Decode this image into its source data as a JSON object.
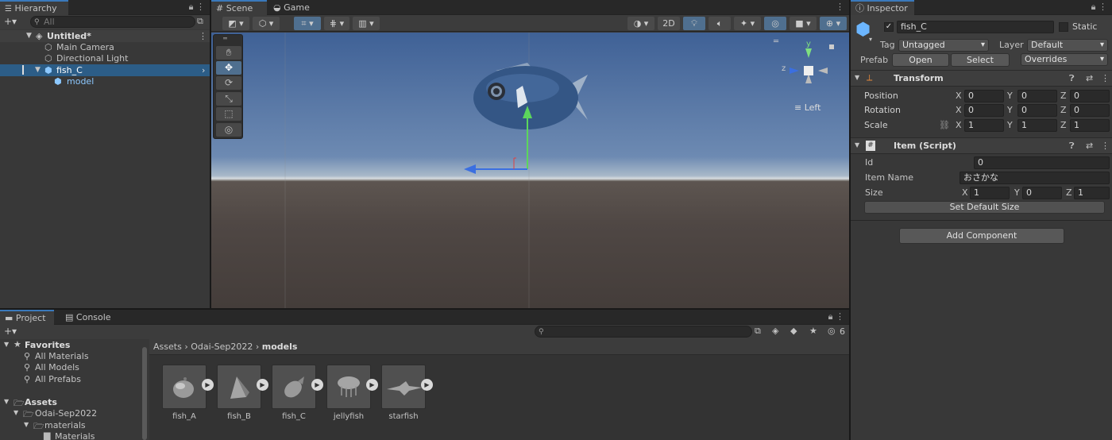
{
  "hierarchy": {
    "tab": "Hierarchy",
    "add_label": "+▾",
    "search_placeholder": "All",
    "scene": "Untitled*",
    "items": [
      "Main Camera",
      "Directional Light",
      "fish_C",
      "model"
    ]
  },
  "scene_view": {
    "tabs": [
      "Scene",
      "Game"
    ],
    "toggle_2d": "2D",
    "view_label": "Left",
    "gizmo_axes": {
      "y": "y",
      "z": "z"
    }
  },
  "inspector": {
    "tab": "Inspector",
    "object_name": "fish_C",
    "static_label": "Static",
    "tag_label": "Tag",
    "tag_value": "Untagged",
    "layer_label": "Layer",
    "layer_value": "Default",
    "prefab_label": "Prefab",
    "prefab_open": "Open",
    "prefab_select": "Select",
    "prefab_overrides": "Overrides",
    "transform": {
      "title": "Transform",
      "position_label": "Position",
      "rotation_label": "Rotation",
      "scale_label": "Scale",
      "position": [
        "0",
        "0",
        "0"
      ],
      "rotation": [
        "0",
        "0",
        "0"
      ],
      "scale": [
        "1",
        "1",
        "1"
      ]
    },
    "axis": [
      "X",
      "Y",
      "Z"
    ],
    "item_script": {
      "title": "Item (Script)",
      "id_label": "Id",
      "id_value": "0",
      "name_label": "Item Name",
      "name_value": "おさかな",
      "size_label": "Size",
      "size": [
        "1",
        "0",
        "1"
      ],
      "default_button": "Set Default Size"
    },
    "add_component": "Add Component"
  },
  "project": {
    "tabs": [
      "Project",
      "Console"
    ],
    "add_label": "+▾",
    "hidden_count": "6",
    "favorites_label": "Favorites",
    "favorites": [
      "All Materials",
      "All Models",
      "All Prefabs"
    ],
    "assets_label": "Assets",
    "tree": [
      "Odai-Sep2022",
      "materials",
      "Materials"
    ],
    "breadcrumb": [
      "Assets",
      "Odai-Sep2022",
      "models"
    ],
    "assets": [
      "fish_A",
      "fish_B",
      "fish_C",
      "jellyfish",
      "starfish"
    ]
  }
}
